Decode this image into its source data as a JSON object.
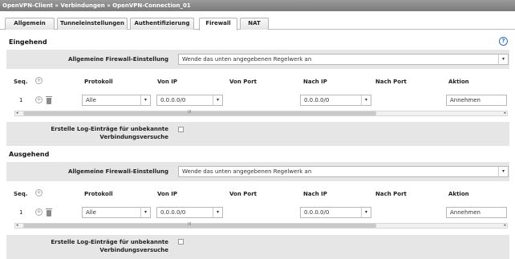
{
  "breadcrumb": "OpenVPN-Client » Verbindungen » OpenVPN-Connection_01",
  "tabs": [
    "Allgemein",
    "Tunneleinstellungen",
    "Authentifizierung",
    "Firewall",
    "NAT"
  ],
  "active_tab": "Firewall",
  "help_symbol": "?",
  "incoming": {
    "title": "Eingehend",
    "general_label": "Allgemeine Firewall-Einstellung",
    "general_value": "Wende das unten angegebenen Regelwerk an",
    "columns": [
      "Seq.",
      "Protokoll",
      "Von IP",
      "Von Port",
      "Nach IP",
      "Nach Port",
      "Aktion"
    ],
    "rows": [
      {
        "seq": "1",
        "protocol": "Alle",
        "from_ip": "0.0.0.0/0",
        "to_ip": "0.0.0.0/0",
        "action": "Annehmen"
      }
    ],
    "log_label_1": "Erstelle Log-Einträge für unbekannte",
    "log_label_2": "Verbindungsversuche"
  },
  "outgoing": {
    "title": "Ausgehend",
    "general_label": "Allgemeine Firewall-Einstellung",
    "general_value": "Wende das unten angegebenen Regelwerk an",
    "columns": [
      "Seq.",
      "Protokoll",
      "Von IP",
      "Von Port",
      "Nach IP",
      "Nach Port",
      "Aktion"
    ],
    "rows": [
      {
        "seq": "1",
        "protocol": "Alle",
        "from_ip": "0.0.0.0/0",
        "to_ip": "0.0.0.0/0",
        "action": "Annehmen"
      }
    ],
    "log_label_1": "Erstelle Log-Einträge für unbekannte",
    "log_label_2": "Verbindungsversuche"
  },
  "icons": {
    "dropdown": "▾",
    "add": "+",
    "scroll_left": "◂",
    "scroll_right": "▸",
    "grip": "III"
  }
}
